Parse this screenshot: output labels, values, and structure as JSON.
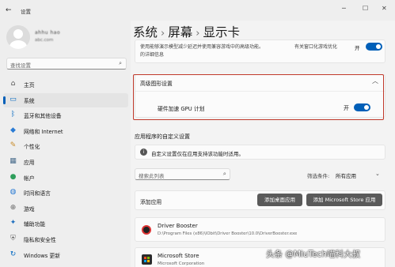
{
  "window": {
    "back_glyph": "←",
    "title": "设置",
    "minimize_glyph": "─",
    "maximize_glyph": "☐",
    "close_glyph": "✕"
  },
  "user": {
    "name": "ahhu hao",
    "email": "abc.com"
  },
  "sidebar": {
    "search_placeholder": "查找设置",
    "search_icon": "search-icon",
    "items": [
      {
        "label": "主页",
        "icon": "home-icon",
        "glyph": "⌂",
        "color": "#555555",
        "active": false
      },
      {
        "label": "系统",
        "icon": "monitor-icon",
        "glyph": "▭",
        "color": "#0067c0",
        "active": true
      },
      {
        "label": "蓝牙和其他设备",
        "icon": "bluetooth-icon",
        "glyph": "ᛒ",
        "color": "#0067c0",
        "active": false
      },
      {
        "label": "网络和 Internet",
        "icon": "wifi-icon",
        "glyph": "◆",
        "color": "#2a7bd4",
        "active": false
      },
      {
        "label": "个性化",
        "icon": "brush-icon",
        "glyph": "✎",
        "color": "#c88a28",
        "active": false
      },
      {
        "label": "应用",
        "icon": "apps-icon",
        "glyph": "▦",
        "color": "#4a6d8c",
        "active": false
      },
      {
        "label": "帐户",
        "icon": "account-icon",
        "glyph": "●",
        "color": "#2e9e5b",
        "active": false
      },
      {
        "label": "时间和语言",
        "icon": "globe-icon",
        "glyph": "◍",
        "color": "#2a7bd4",
        "active": false
      },
      {
        "label": "游戏",
        "icon": "gamepad-icon",
        "glyph": "⊕",
        "color": "#666666",
        "active": false
      },
      {
        "label": "辅助功能",
        "icon": "accessibility-icon",
        "glyph": "✦",
        "color": "#1f6fbf",
        "active": false
      },
      {
        "label": "隐私和安全性",
        "icon": "shield-icon",
        "glyph": "⛨",
        "color": "#6b6b6b",
        "active": false
      },
      {
        "label": "Windows 更新",
        "icon": "update-icon",
        "glyph": "↻",
        "color": "#0067c0",
        "active": false
      }
    ]
  },
  "breadcrumb": {
    "items": [
      "系统",
      "屏幕",
      "显示卡"
    ],
    "separator": "›"
  },
  "top_card": {
    "line1": "使用能够演示模型减少延迟并使用兼容游戏中的高级功能。",
    "line2": "的详细信息",
    "link": "有关窗口化游戏优化",
    "toggle_label": "开",
    "toggle_on": true
  },
  "advanced_graphics": {
    "title": "高级图形设置",
    "chevron": "︿",
    "setting_label": "硬件加速 GPU 计划",
    "toggle_label": "开",
    "toggle_on": true,
    "highlight_color": "#c0392b"
  },
  "app_settings": {
    "section_title": "应用程序的自定义设置",
    "info_text": "自定义设置仅在应用支持该功能时适用。",
    "list_search_placeholder": "搜索此列表",
    "filter_label": "筛选条件:",
    "filter_value": "所有应用",
    "add_app_label": "添加应用",
    "add_desktop_button": "添加桌面应用",
    "add_store_button": "添加 Microsoft Store 应用",
    "apps": [
      {
        "name": "Driver Booster",
        "path": "D:\\Program Files (x86)\\IObit\\Driver Booster\\10.0\\DriverBooster.exe",
        "icon": "driver-booster-icon"
      },
      {
        "name": "Microsoft Store",
        "path": "Microsoft Corporation",
        "icon": "store-icon"
      }
    ]
  },
  "watermark": "头条 @MiuTech喵科大叔",
  "accent_color": "#005fb8"
}
